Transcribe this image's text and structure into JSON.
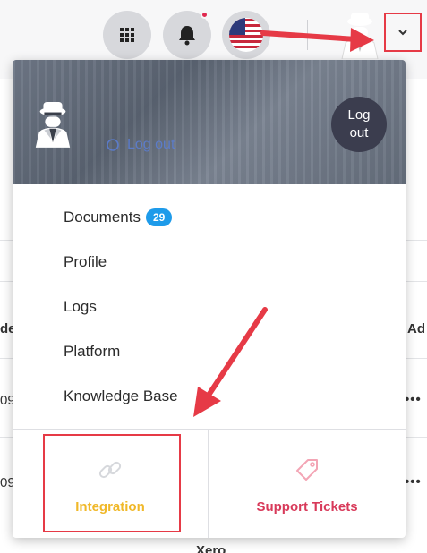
{
  "background": {
    "row_fragments": [
      "de",
      "Ad",
      "09",
      "09",
      "Xero"
    ]
  },
  "topbar": {
    "apps_icon": "grid-icon",
    "notifications_icon": "bell-icon",
    "language_icon": "us-flag-icon",
    "user_icon": "spy-avatar-icon",
    "menu_icon": "chevron-down-icon"
  },
  "dropdown": {
    "header": {
      "logout_link": "Log out",
      "logout_button": "Log out"
    },
    "menu": [
      {
        "label": "Documents",
        "badge": "29"
      },
      {
        "label": "Profile"
      },
      {
        "label": "Logs"
      },
      {
        "label": "Platform"
      },
      {
        "label": "Knowledge Base"
      }
    ],
    "tiles": {
      "integration": {
        "label": "Integration",
        "icon": "link-icon",
        "color": "#f0b829"
      },
      "support": {
        "label": "Support Tickets",
        "icon": "tag-icon",
        "color": "#d83a5a"
      }
    }
  },
  "colors": {
    "annotation": "#e63a46",
    "badge": "#1e9bea",
    "logout_button": "#3b3d4e"
  }
}
